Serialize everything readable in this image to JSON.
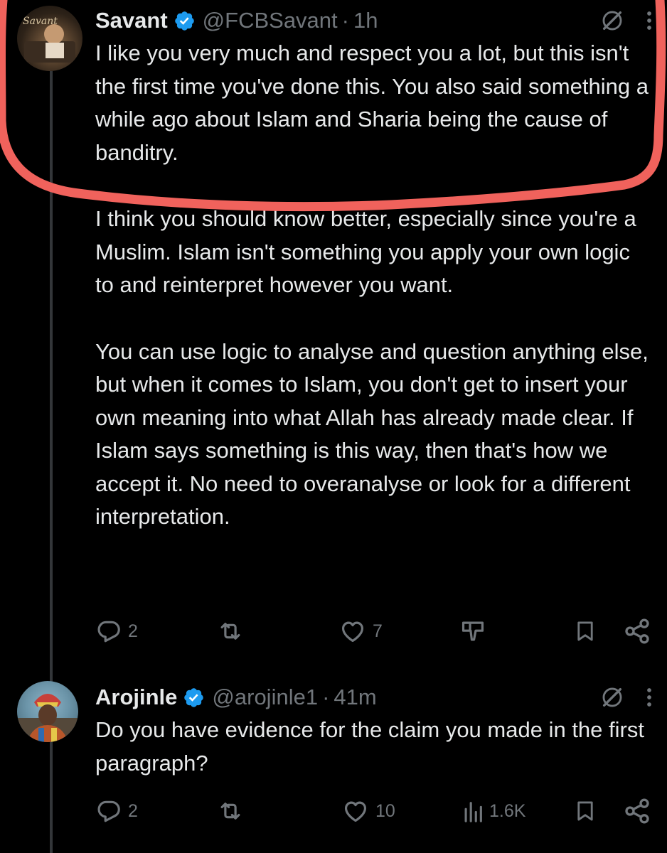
{
  "posts": [
    {
      "name": "Savant",
      "handle": "@FCBSavant",
      "separator": "·",
      "time": "1h",
      "avatar_icon": "profile-photo",
      "verified_icon": "verified-badge-icon",
      "paragraphs": [
        "I like you very much and respect you a lot, but this isn't the first time you've done this. You also said something a while ago about Islam and Sharia being the cause of banditry.",
        "I think you should know better, especially since you're a Muslim. Islam isn't something you apply your own logic to and reinterpret however you want.",
        "You can use logic to analyse and question anything else, but when it comes to Islam, you don't get to insert your own meaning into what Allah has already made clear. If Islam says something is this way, then that's how we accept it. No need to overanalyse or look for a different interpretation."
      ],
      "actions": {
        "replies": "2",
        "reposts": "",
        "likes": "7",
        "views": ""
      }
    },
    {
      "name": "Arojinle",
      "handle": "@arojinle1",
      "separator": "·",
      "time": "41m",
      "avatar_icon": "profile-photo",
      "verified_icon": "verified-badge-icon",
      "paragraphs": [
        "Do you have evidence for the claim you made in the first paragraph?"
      ],
      "actions": {
        "replies": "2",
        "reposts": "",
        "likes": "10",
        "views": "1.6K"
      }
    }
  ],
  "colors": {
    "background": "#000000",
    "text": "#e7e9ea",
    "muted": "#71767b",
    "verified": "#1d9bf0",
    "annotation": "#f0625c"
  }
}
